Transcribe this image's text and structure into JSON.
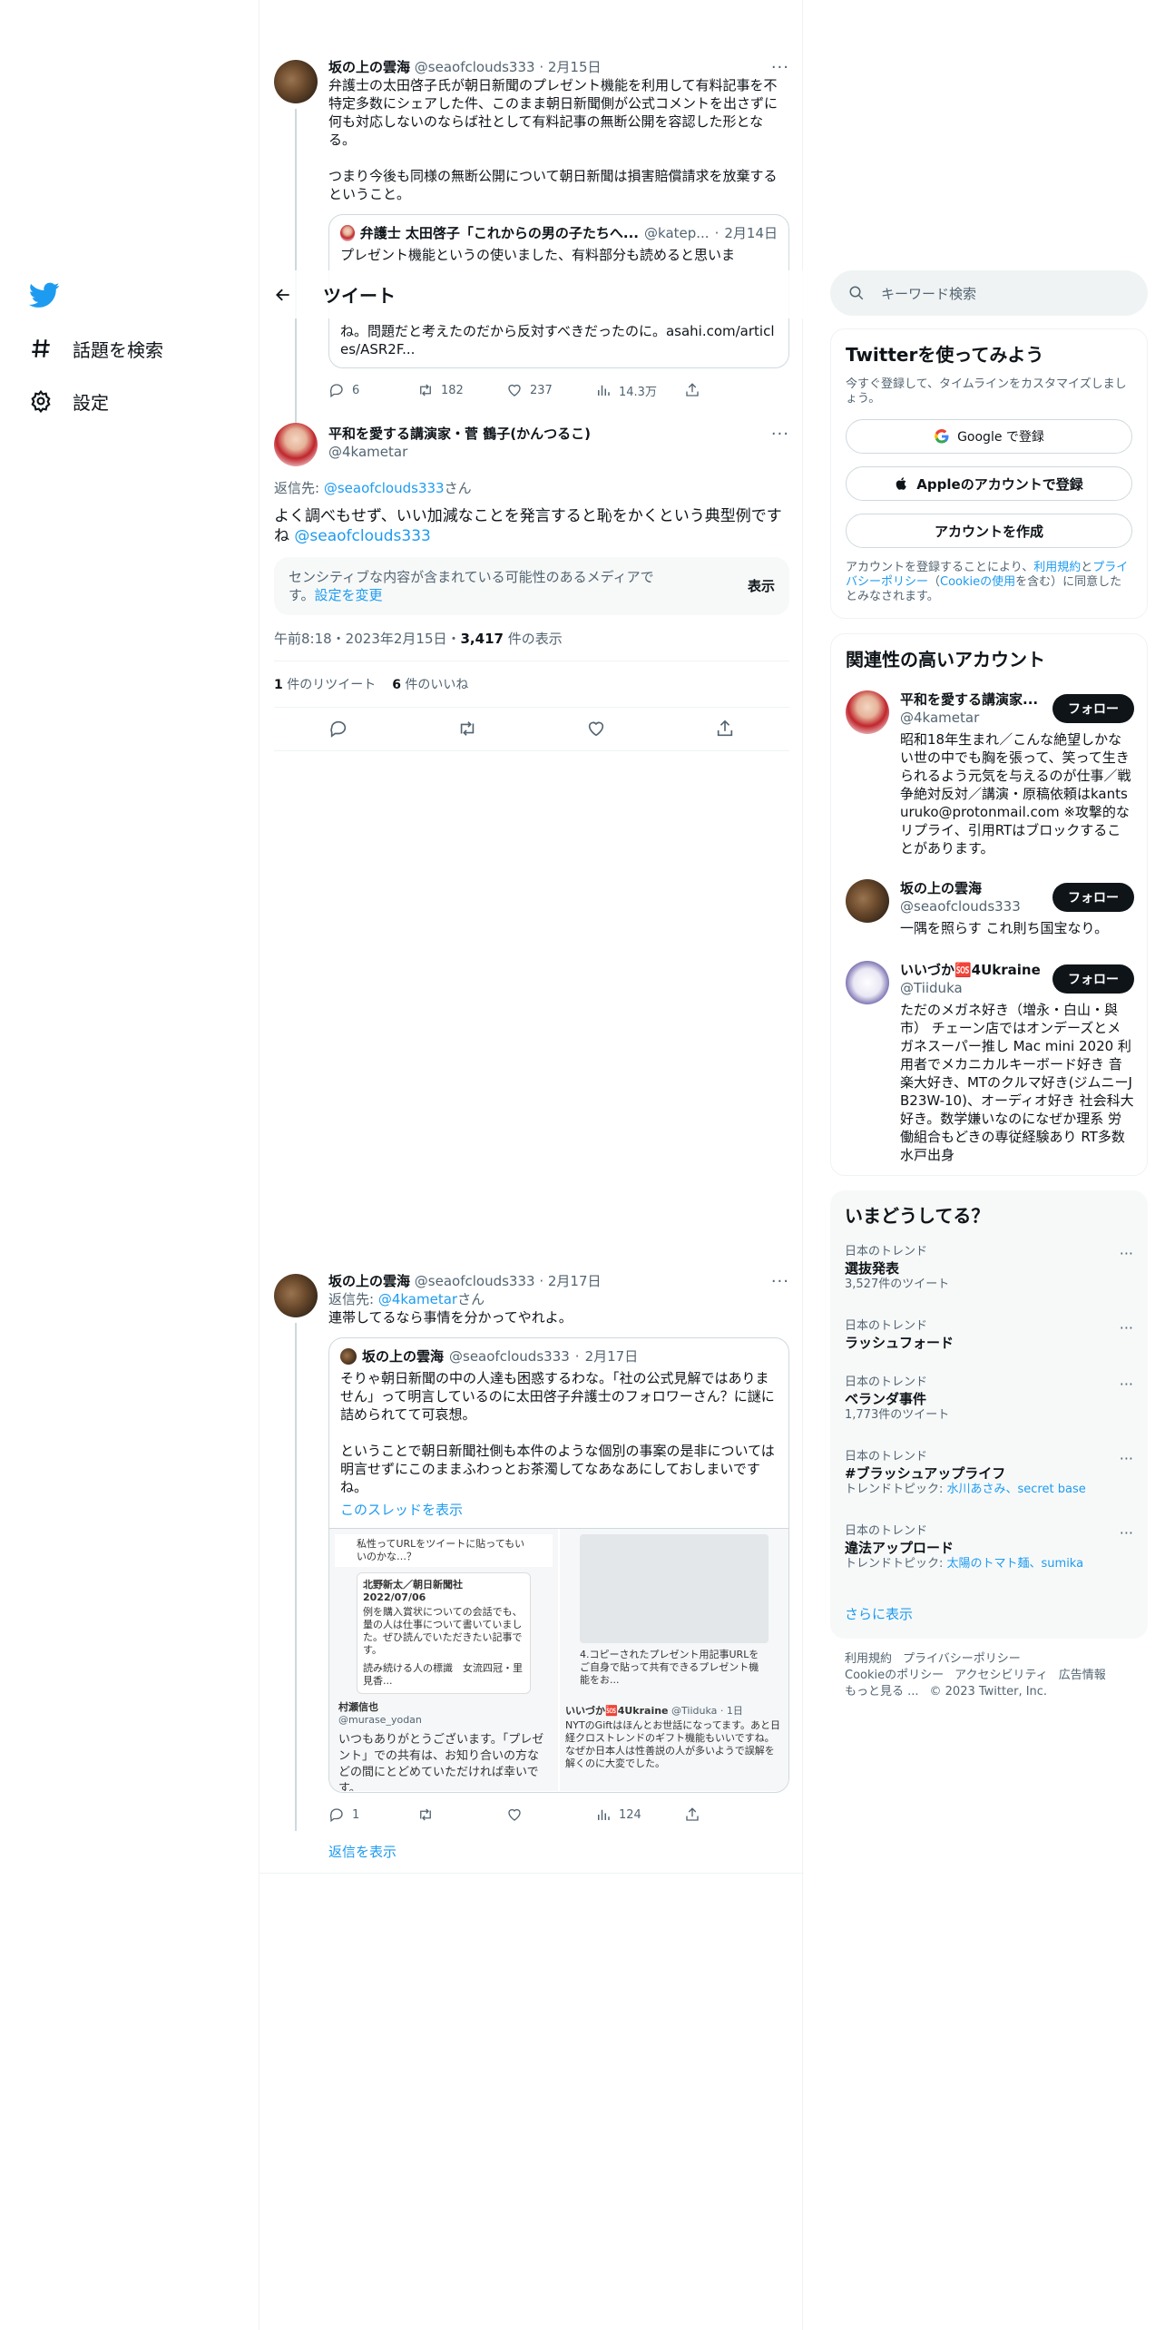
{
  "nav": {
    "explore_label": "話題を検索",
    "settings_label": "設定"
  },
  "header": {
    "title": "ツイート"
  },
  "tweet1": {
    "name": "坂の上の雲海",
    "handle": "@seaofclouds333",
    "date": "2月15日",
    "text": "弁護士の太田啓子氏が朝日新聞のプレゼント機能を利用して有料記事を不特定多数にシェアした件、このまま朝日新聞側が公式コメントを出さずに何も対応しないのならば社として有料記事の無断公開を容認した形となる。\n\nつまり今後も同様の無断公開について朝日新聞は損害賠償請求を放棄するということ。",
    "quote": {
      "name": "弁護士 太田啓子「これからの男の子たちへ...",
      "handle": "@katep...",
      "date": "2月14日",
      "text_top": "プレゼント機能というの使いました、有料部分も読めると思いま",
      "text_bottom": "ね。問題だと考えたのだから反対すべきだったのに。asahi.com/articles/ASR2F..."
    },
    "replies": "6",
    "retweets": "182",
    "likes": "237",
    "views": "14.3万"
  },
  "main_tweet": {
    "name": "平和を愛する講演家・菅 鶴子(かんつるこ)",
    "handle": "@4kametar",
    "reply_prefix": "返信先: ",
    "reply_to": "@seaofclouds333",
    "reply_suffix": "さん",
    "text": "よく調べもせず、いい加減なことを発言すると恥をかくという典型例ですね ",
    "text_mention": "@seaofclouds333",
    "sensitive_text": "センシティブな内容が含まれている可能性のあるメディアです。",
    "sensitive_link": "設定を変更",
    "show_label": "表示",
    "time": "午前8:18・2023年2月15日・",
    "views_count": "3,417",
    "views_label": " 件の表示",
    "retweets_count": "1",
    "retweets_label": " 件のリツイート",
    "likes_count": "6",
    "likes_label": " 件のいいね"
  },
  "reply_tweet": {
    "name": "坂の上の雲海",
    "handle": "@seaofclouds333",
    "date": "2月17日",
    "reply_prefix": "返信先: ",
    "reply_to": "@4kametar",
    "reply_suffix": "さん",
    "text": "連帯してるなら事情を分かってやれよ。",
    "quote": {
      "name": "坂の上の雲海",
      "handle": "@seaofclouds333",
      "date": "2月17日",
      "text": "そりゃ朝日新聞の中の人達も困惑するわな。「社の公式見解ではありません」って明言しているのに太田啓子弁護士のフォロワーさん？に謎に詰められてて可哀想。\n\nということで朝日新聞社側も本件のような個別の事案の是非については明言せずにこのままふわっとお茶濁してなあなあにしておしまいですね。",
      "thread_link": "このスレッドを表示",
      "media_left_top": "私性ってURLをツイートに貼ってもいいのかな…？",
      "media_left_src": "北野新太／朝日新聞社 2022/07/06",
      "media_left_quote": "例を購入賞状についての会話でも、量の人は仕事について書いていました。ぜひ読んでいただきたい記事です。",
      "media_left_sub": "読み続ける人の標識　女流四冠・里見香...",
      "media_left_user": "村瀬信也",
      "media_left_handle": "@murase_yodan",
      "media_left_text": "いつもありがとうございます。「プレゼント」での共有は、お知り合いの方などの間にとどめていただければ幸いです。",
      "media_right_caption": "4.コピーされたプレゼント用記事URLをご自身で貼って共有できるプレゼント機能をお...",
      "media_right_user": "いいづか🆘4Ukraine",
      "media_right_handle": "@Tiiduka · 1日",
      "media_right_text": "NYTのGiftはほんとお世話になってます。あと日経クロストレンドのギフト機能もいいですね。なぜか日本人は性善説の人が多いようで誤解を解くのに大変でした。"
    },
    "replies": "1",
    "views": "124",
    "show_replies": "返信を表示"
  },
  "search": {
    "placeholder": "キーワード検索"
  },
  "signup": {
    "title": "Twitterを使ってみよう",
    "subtitle": "今すぐ登録して、タイムラインをカスタマイズしましょう。",
    "google": "Google で登録",
    "apple": "Appleのアカウントで登録",
    "create": "アカウントを作成",
    "terms_pre": "アカウントを登録することにより、",
    "terms_link1": "利用規約",
    "terms_and": "と",
    "terms_link2": "プライバシーポリシー",
    "terms_paren_open": "（",
    "terms_link3": "Cookieの使用",
    "terms_post": "を含む）に同意したとみなされます。"
  },
  "related": {
    "title": "関連性の高いアカウント",
    "follow_label": "フォロー",
    "accounts": [
      {
        "name": "平和を愛する講演家...",
        "handle": "@4kametar",
        "bio": "昭和18年生まれ／こんな絶望しかない世の中でも胸を張って、笑って生きられるよう元気を与えるのが仕事／戦争絶対反対／講演・原稿依頼はkantsuruko@protonmail.com ※攻撃的なリプライ、引用RTはブロックすることがあります。"
      },
      {
        "name": "坂の上の雲海",
        "handle": "@seaofclouds333",
        "bio": "一隅を照らす これ則ち国宝なり。"
      },
      {
        "name": "いいづか🆘4Ukraine",
        "handle": "@Tiiduka",
        "bio": "ただのメガネ好き（増永・白山・與市） チェーン店ではオンデーズとメガネスーパー推し Mac mini 2020 利用者でメカニカルキーボード好き 音楽大好き、MTのクルマ好き(ジムニーJB23W-10)、オーディオ好き 社会科大好き。数学嫌いなのになぜか理系 労働組合もどきの専従経験あり RT多数 水戸出身"
      }
    ]
  },
  "trends": {
    "title": "いまどうしてる？",
    "items": [
      {
        "category": "日本のトレンド",
        "name": "選抜発表",
        "count": "3,527件のツイート"
      },
      {
        "category": "日本のトレンド",
        "name": "ラッシュフォード",
        "count": ""
      },
      {
        "category": "日本のトレンド",
        "name": "ベランダ事件",
        "count": "1,773件のツイート"
      },
      {
        "category": "日本のトレンド",
        "name": "#ブラッシュアップライフ",
        "topic_label": "トレンドトピック: ",
        "topic": "水川あさみ、secret base"
      },
      {
        "category": "日本のトレンド",
        "name": "違法アップロード",
        "topic_label": "トレンドトピック: ",
        "topic": "太陽のトマト麺、sumika"
      }
    ],
    "show_more": "さらに表示"
  },
  "footer": {
    "terms": "利用規約",
    "privacy": "プライバシーポリシー",
    "cookie": "Cookieのポリシー",
    "accessibility": "アクセシビリティ",
    "ads": "広告情報",
    "more": "もっと見る ...",
    "copyright": "© 2023 Twitter, Inc."
  },
  "colors": {
    "accent": "#1d9bf0",
    "text": "#0f1419",
    "muted": "#536471"
  }
}
